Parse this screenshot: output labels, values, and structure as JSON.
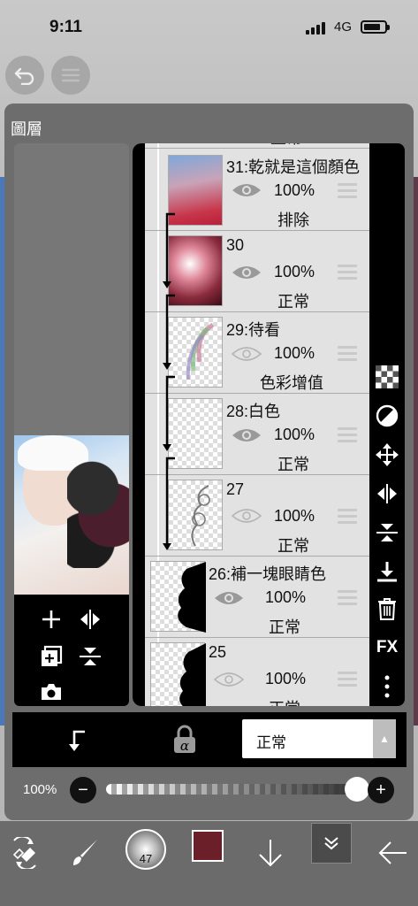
{
  "status": {
    "time": "9:11",
    "network": "4G"
  },
  "panel": {
    "title": "圖層"
  },
  "layers": [
    {
      "name": "",
      "opacity": "",
      "blend": "正常"
    },
    {
      "name": "31:乾就是這個顏色",
      "opacity": "100%",
      "blend": "排除"
    },
    {
      "name": "30",
      "opacity": "100%",
      "blend": "正常"
    },
    {
      "name": "29:待看",
      "opacity": "100%",
      "blend": "色彩增值"
    },
    {
      "name": "28:白色",
      "opacity": "100%",
      "blend": "正常"
    },
    {
      "name": "27",
      "opacity": "100%",
      "blend": "正常"
    },
    {
      "name": "26:補一塊眼睛色",
      "opacity": "100%",
      "blend": "正常"
    },
    {
      "name": "25",
      "opacity": "100%",
      "blend": "正常"
    }
  ],
  "right_tools": {
    "fx_label": "FX"
  },
  "blend_mode": {
    "selected": "正常"
  },
  "opacity_slider": {
    "label": "100%",
    "value": 1.0
  },
  "brush": {
    "size": "47"
  },
  "colors": {
    "brush_color": "#6b1f28",
    "panel_bg": "#6d6d6d",
    "list_bg": "#e2e2e2"
  }
}
